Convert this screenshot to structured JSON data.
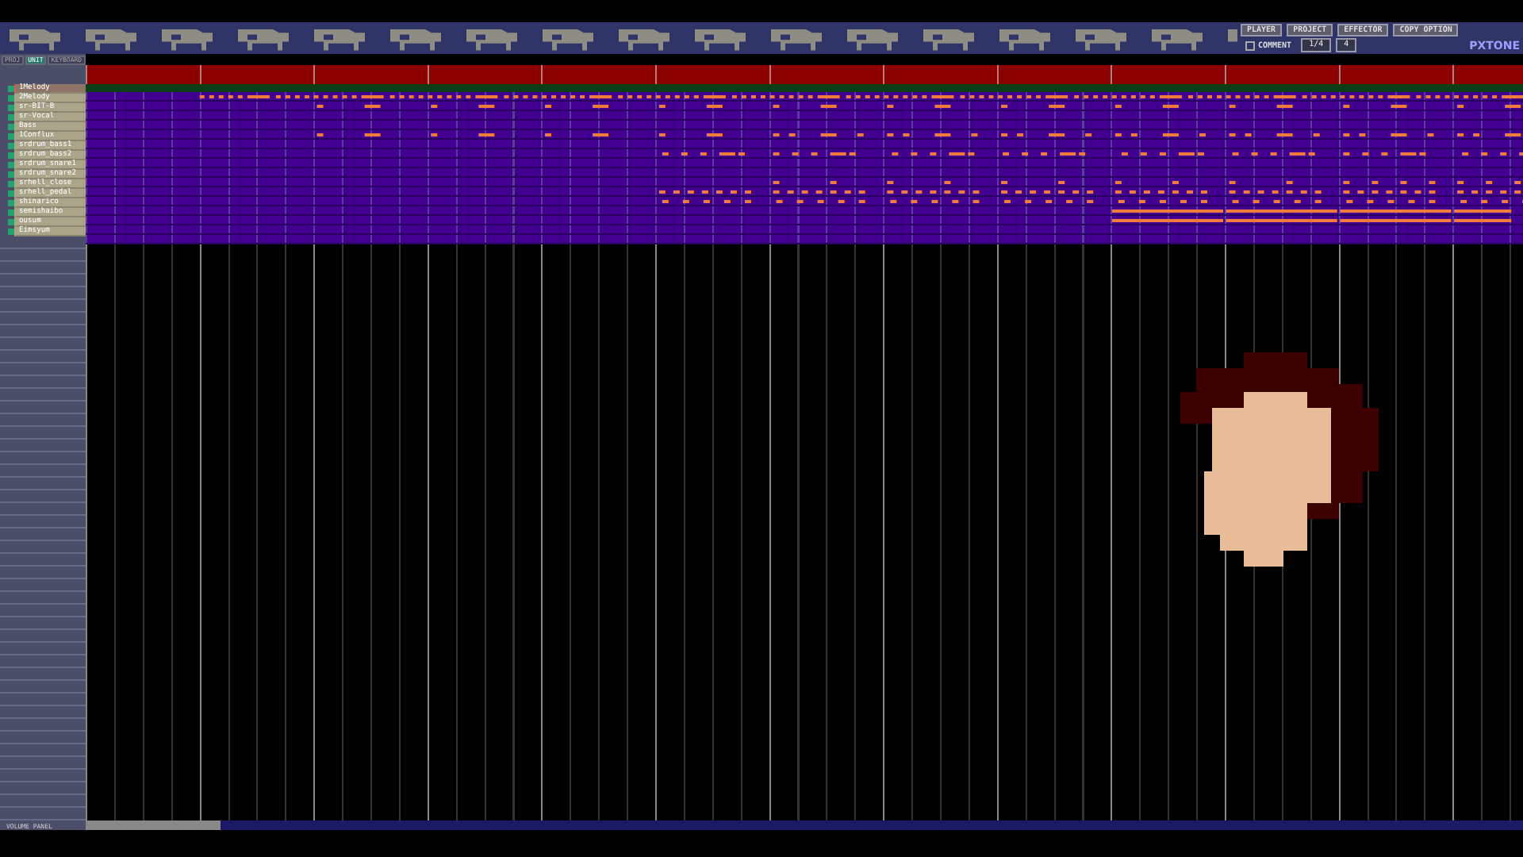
{
  "top_buttons": [
    "PLAYER",
    "PROJECT",
    "EFFECTOR",
    "COPY OPTION"
  ],
  "comment": {
    "label": "COMMENT",
    "checked": false
  },
  "zoom": {
    "value": "1/4"
  },
  "division": {
    "value": "4"
  },
  "logo": "PXTONE",
  "tabs": [
    {
      "label": "PROJ",
      "selected": false
    },
    {
      "label": "UNIT",
      "selected": true
    },
    {
      "label": "KEYBOARD",
      "selected": false
    }
  ],
  "units": [
    {
      "name": "1Melody",
      "selected": true
    },
    {
      "name": "2Melody",
      "selected": false
    },
    {
      "name": "sr-BIT-B",
      "selected": false
    },
    {
      "name": "sr-Vocal",
      "selected": false
    },
    {
      "name": "Bass",
      "selected": false
    },
    {
      "name": "1Conflux",
      "selected": false
    },
    {
      "name": "srdrum_bass1",
      "selected": false
    },
    {
      "name": "srdrum_bass2",
      "selected": false
    },
    {
      "name": "srdrum_snare1",
      "selected": false
    },
    {
      "name": "srdrum_snare2",
      "selected": false
    },
    {
      "name": "srhell_close",
      "selected": false
    },
    {
      "name": "srhell_pedal",
      "selected": false
    },
    {
      "name": "shinarico",
      "selected": false
    },
    {
      "name": "semishaibo",
      "selected": false
    },
    {
      "name": "ousum",
      "selected": false
    },
    {
      "name": "Eimsyum",
      "selected": false
    }
  ],
  "footer": "VOLUME PANEL"
}
